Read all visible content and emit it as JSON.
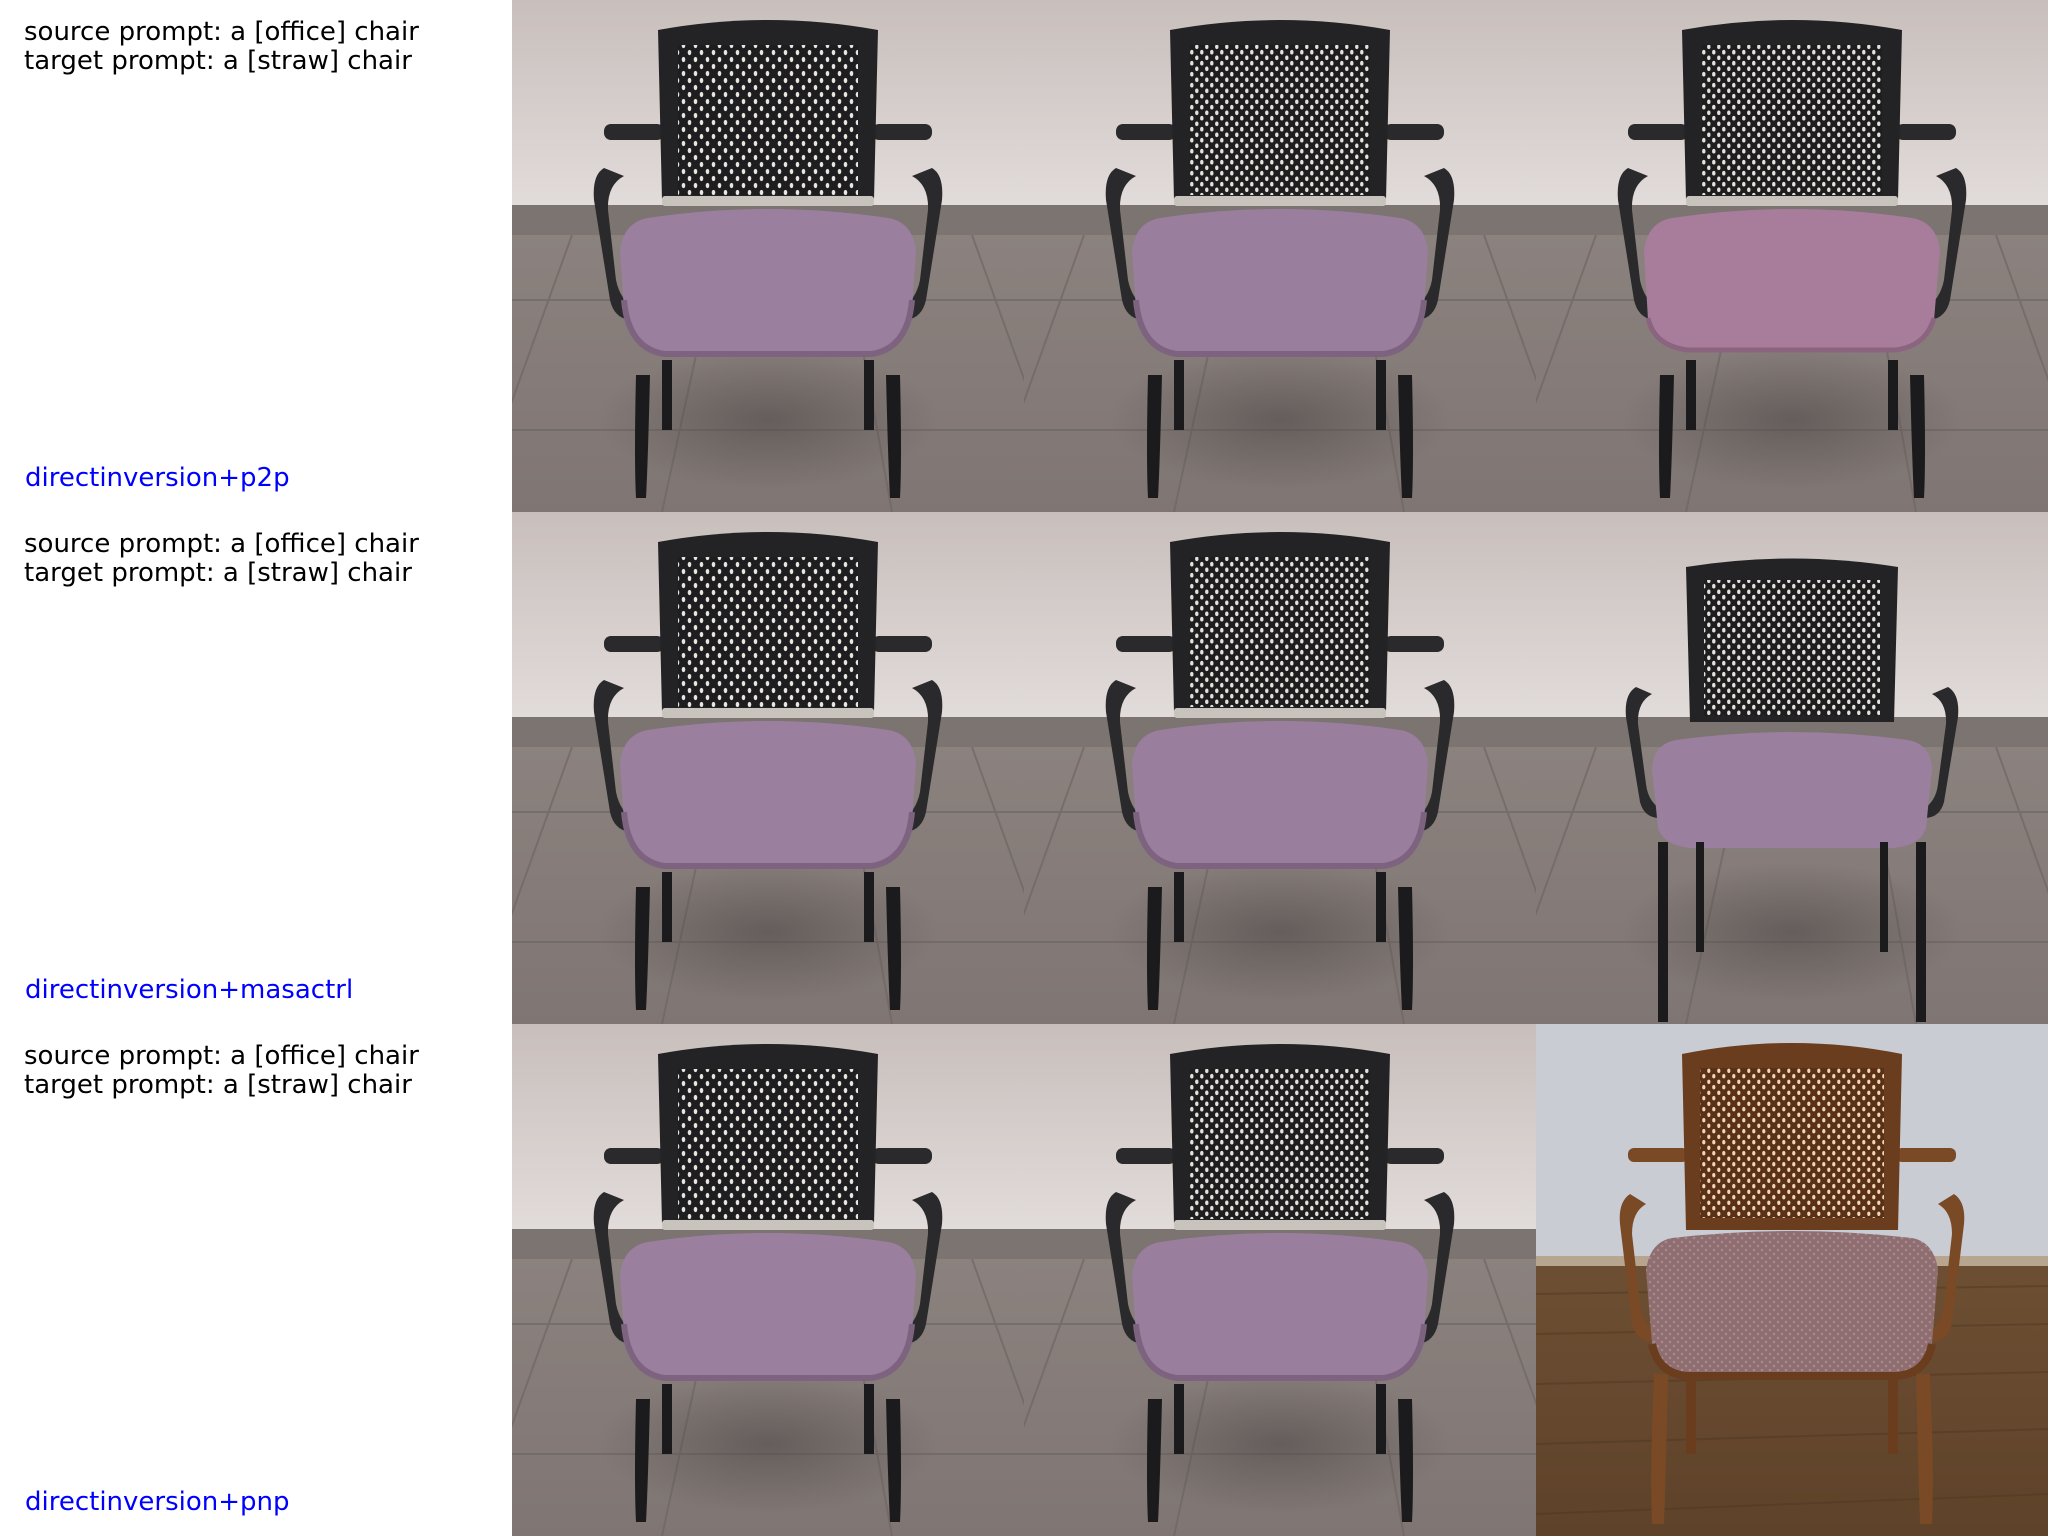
{
  "rows": [
    {
      "source_prompt": "source prompt: a [office] chair",
      "target_prompt": "target prompt: a [straw] chair",
      "method": "directinversion+p2p",
      "method_color": "#0000ff",
      "panels": [
        {
          "subject": "office chair",
          "frame": "black",
          "seat": "purple",
          "backrest": "mesh",
          "floor": "grey tile",
          "wall": "light"
        },
        {
          "subject": "office chair",
          "frame": "black",
          "seat": "purple",
          "backrest": "mesh",
          "floor": "grey tile",
          "wall": "light"
        },
        {
          "subject": "office chair",
          "frame": "black",
          "seat": "pink-purple",
          "backrest": "mesh",
          "floor": "grey tile",
          "wall": "light"
        }
      ]
    },
    {
      "source_prompt": "source prompt: a [office] chair",
      "target_prompt": "target prompt: a [straw] chair",
      "method": "directinversion+masactrl",
      "method_color": "#0000ff",
      "panels": [
        {
          "subject": "office chair",
          "frame": "black",
          "seat": "purple",
          "backrest": "mesh",
          "floor": "grey tile",
          "wall": "light"
        },
        {
          "subject": "office chair",
          "frame": "black",
          "seat": "purple",
          "backrest": "mesh",
          "floor": "grey tile",
          "wall": "light"
        },
        {
          "subject": "office chair",
          "frame": "black",
          "seat": "purple",
          "backrest": "mesh",
          "floor": "grey tile",
          "wall": "light"
        }
      ]
    },
    {
      "source_prompt": "source prompt: a [office] chair",
      "target_prompt": "target prompt: a [straw] chair",
      "method": "directinversion+pnp",
      "method_color": "#0000ff",
      "panels": [
        {
          "subject": "office chair",
          "frame": "black",
          "seat": "purple",
          "backrest": "mesh",
          "floor": "grey tile",
          "wall": "light"
        },
        {
          "subject": "office chair",
          "frame": "black",
          "seat": "purple",
          "backrest": "mesh",
          "floor": "grey tile",
          "wall": "light"
        },
        {
          "subject": "wooden chair",
          "frame": "brown wood",
          "seat": "brown",
          "backrest": "mesh",
          "floor": "wood",
          "wall": "light blue-grey"
        }
      ]
    }
  ],
  "colors": {
    "text": "#000000",
    "method_label": "#0000ff",
    "wall": "#d6cfcc",
    "tile_floor": "#8d8480",
    "chair_frame": "#2a2a2c",
    "seat_purple": "#9b7f9f",
    "seat_pink": "#a87d9c",
    "wood_frame": "#7a4a26",
    "wood_floor": "#6e5035",
    "cool_wall": "#c9ccd3"
  }
}
